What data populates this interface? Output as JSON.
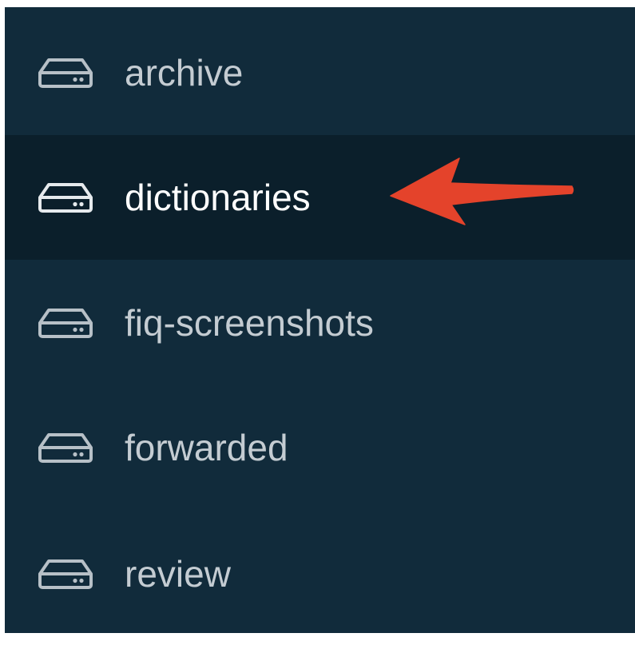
{
  "sidebar": {
    "items": [
      {
        "label": "archive",
        "icon": "drive-icon",
        "selected": false
      },
      {
        "label": "dictionaries",
        "icon": "drive-icon",
        "selected": true
      },
      {
        "label": "fiq-screenshots",
        "icon": "drive-icon",
        "selected": false
      },
      {
        "label": "forwarded",
        "icon": "drive-icon",
        "selected": false
      },
      {
        "label": "review",
        "icon": "drive-icon",
        "selected": false
      }
    ]
  },
  "colors": {
    "panel_background": "#112b3b",
    "selected_background": "#0b1f2b",
    "label_text": "#c4ccd2",
    "selected_label_text": "#ffffff",
    "icon_stroke": "#b7c0c7",
    "annotation_arrow": "#e4432b"
  },
  "annotation": {
    "type": "arrow",
    "points_to": "dictionaries"
  }
}
